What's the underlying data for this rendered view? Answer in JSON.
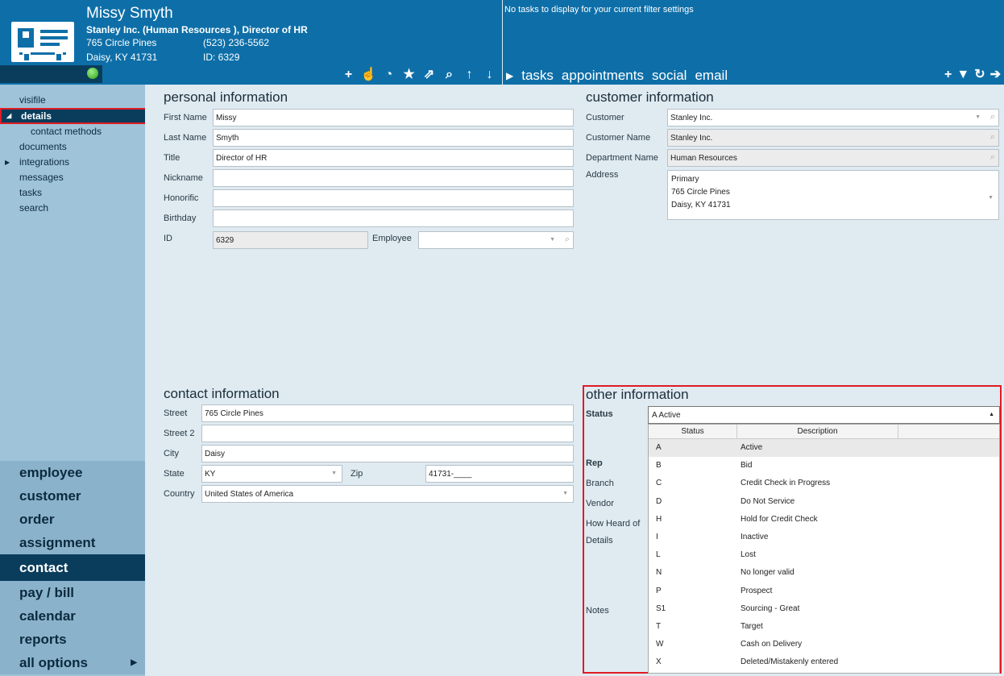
{
  "header": {
    "name": "Missy Smyth",
    "company_line": "Stanley Inc.  (Human Resources ), Director of HR",
    "street": "765 Circle Pines",
    "phone": "(523) 236-5562",
    "city": "Daisy, KY    41731",
    "id_line": "ID:  6329",
    "tasks_message": "No tasks to display for your current filter settings",
    "tabs": [
      "tasks",
      "appointments",
      "social",
      "email"
    ],
    "toolbar_icons": [
      "plus-icon",
      "pointer-icon",
      "pie-icon",
      "star-icon",
      "external-link-icon",
      "search-icon",
      "arrow-up-icon",
      "arrow-down-icon"
    ],
    "right_icons": [
      "plus-icon",
      "filter-icon",
      "refresh-icon",
      "arrow-right-icon"
    ],
    "status_color": "#2c9e13"
  },
  "sidebar": {
    "items": [
      {
        "label": "visifile"
      },
      {
        "label": "details",
        "selected": true,
        "arrow": "◢"
      },
      {
        "label": "contact methods",
        "sub": true
      },
      {
        "label": "documents"
      },
      {
        "label": "integrations",
        "arrow": "▶"
      },
      {
        "label": "messages"
      },
      {
        "label": "tasks"
      },
      {
        "label": "search"
      }
    ],
    "bottom": [
      "employee",
      "customer",
      "order",
      "assignment",
      "contact",
      "pay / bill",
      "calendar",
      "reports",
      "all options"
    ],
    "bottom_selected": "contact"
  },
  "personal": {
    "title": "personal information",
    "first_name_label": "First Name",
    "first_name": "Missy",
    "last_name_label": "Last Name",
    "last_name": "Smyth",
    "title_label": "Title",
    "title_value": "Director of HR",
    "nickname_label": "Nickname",
    "honorific_label": "Honorific",
    "birthday_label": "Birthday",
    "id_label": "ID",
    "id_value": "6329",
    "employee_label": "Employee"
  },
  "customer": {
    "title": "customer information",
    "customer_label": "Customer",
    "customer": "Stanley Inc.",
    "customer_name_label": "Customer Name",
    "customer_name": "Stanley Inc.",
    "dept_label": "Department Name",
    "dept": "Human Resources",
    "address_label": "Address",
    "addr1": "Primary",
    "addr2": "765 Circle Pines",
    "addr3": "Daisy, KY 41731"
  },
  "contact": {
    "title": "contact information",
    "street_label": "Street",
    "street": "765 Circle Pines",
    "street2_label": "Street 2",
    "city_label": "City",
    "city": "Daisy",
    "state_label": "State",
    "state": "KY",
    "zip_label": "Zip",
    "zip": "41731-____",
    "country_label": "Country",
    "country": "United States of America"
  },
  "other": {
    "title": "other information",
    "status_label": "Status",
    "status_value": "A  Active",
    "labels": [
      "Rep",
      "Branch",
      "Vendor",
      "How Heard of",
      "Details",
      "Notes"
    ],
    "col_status": "Status",
    "col_desc": "Description",
    "options": [
      [
        "A",
        "Active"
      ],
      [
        "B",
        "Bid"
      ],
      [
        "C",
        "Credit Check in Progress"
      ],
      [
        "D",
        "Do Not Service"
      ],
      [
        "H",
        "Hold for Credit Check"
      ],
      [
        "I",
        "Inactive"
      ],
      [
        "L",
        "Lost"
      ],
      [
        "N",
        "No longer valid"
      ],
      [
        "P",
        "Prospect"
      ],
      [
        "S1",
        "Sourcing - Great"
      ],
      [
        "T",
        "Target"
      ],
      [
        "W",
        "Cash on Delivery"
      ],
      [
        "X",
        "Deleted/Mistakenly entered"
      ]
    ]
  }
}
